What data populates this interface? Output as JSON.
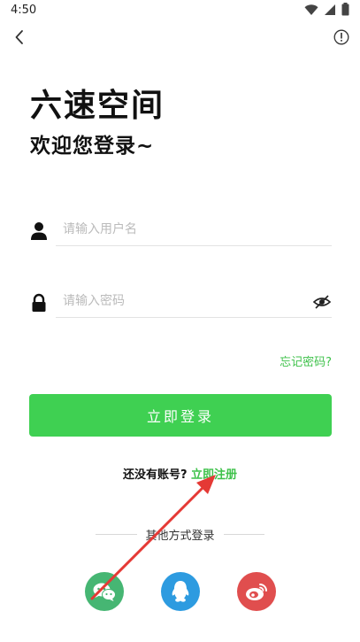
{
  "status_bar": {
    "time": "4:50"
  },
  "header": {
    "app_title": "六速空间",
    "welcome": "欢迎您登录~"
  },
  "form": {
    "username_placeholder": "请输入用户名",
    "password_placeholder": "请输入密码",
    "forgot_password": "忘记密码?",
    "login_label": "立即登录"
  },
  "register": {
    "prompt": "还没有账号?",
    "link": "立即注册"
  },
  "other_login": {
    "title": "其他方式登录",
    "options": [
      "wechat",
      "qq",
      "weibo"
    ]
  },
  "colors": {
    "accent": "#3fd052",
    "link": "#3fc24b",
    "wechat": "#46b673",
    "qq": "#2d9be0",
    "weibo": "#e04e4e",
    "annotation_arrow": "#e53935"
  }
}
